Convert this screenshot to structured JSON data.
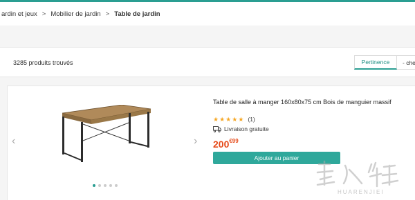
{
  "breadcrumb": {
    "items": [
      "ardin et jeux",
      "Mobilier de jardin"
    ],
    "current": "Table de jardin",
    "separator": ">"
  },
  "results": {
    "count_label": "3285 produits trouvés"
  },
  "sort": {
    "options": [
      "Pertinence",
      "- che"
    ],
    "active": "Pertinence"
  },
  "product": {
    "title": "Table de salle à manger 160x80x75 cm Bois de manguier massif",
    "rating_stars": 5,
    "rating_count": "(1)",
    "delivery": "Livraison gratuite",
    "price_main": "200",
    "price_cents": "€99",
    "cart_label": "Ajouter au panier",
    "carousel_index": 0
  },
  "carousel": {
    "left_arrow": "‹",
    "right_arrow": "›"
  },
  "watermark": {
    "text": "HUARENJIEI"
  },
  "colors": {
    "accent": "#2a9e92",
    "price": "#e64a19",
    "star": "#f5a623"
  }
}
